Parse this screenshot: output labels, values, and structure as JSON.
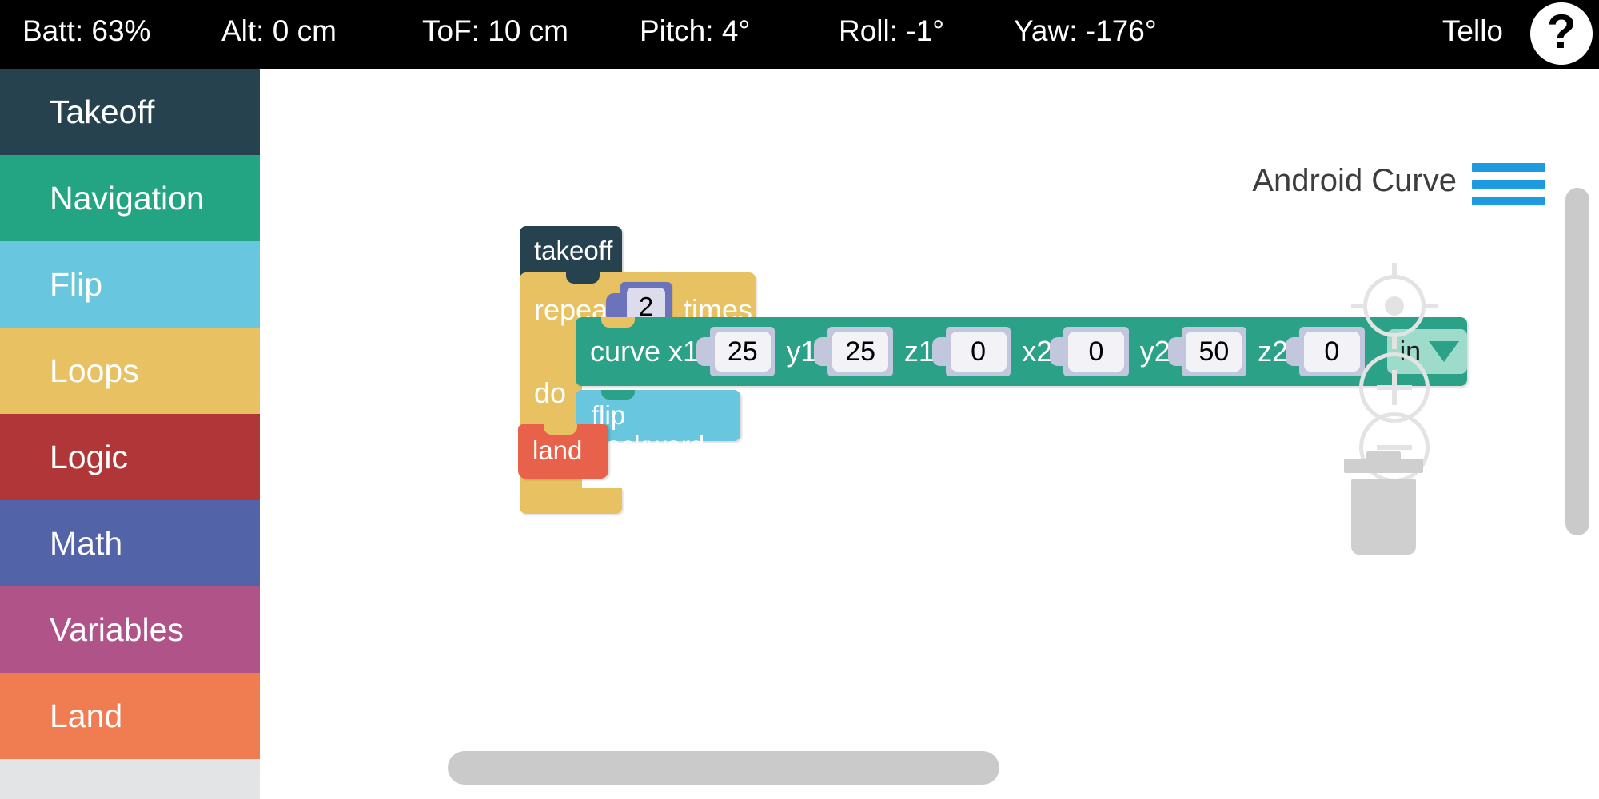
{
  "statusbar": {
    "battery": "Batt: 63%",
    "altitude": "Alt: 0 cm",
    "tof": "ToF: 10 cm",
    "pitch": "Pitch: 4°",
    "roll": "Roll: -1°",
    "yaw": "Yaw: -176°",
    "drone_name": "Tello",
    "help_label": "?"
  },
  "sidebar": {
    "items": [
      {
        "label": "Takeoff",
        "color": "#27424f"
      },
      {
        "label": "Navigation",
        "color": "#23a584"
      },
      {
        "label": "Flip",
        "color": "#68c6de"
      },
      {
        "label": "Loops",
        "color": "#e8c262"
      },
      {
        "label": "Logic",
        "color": "#b03638"
      },
      {
        "label": "Math",
        "color": "#5263a8"
      },
      {
        "label": "Variables",
        "color": "#af5389"
      },
      {
        "label": "Land",
        "color": "#f07c51"
      }
    ]
  },
  "workspace": {
    "project_title": "Android Curve",
    "menu_icon": "hamburger-icon",
    "controls": {
      "center_icon": "crosshair-icon",
      "zoom_in_icon": "plus-icon",
      "zoom_out_icon": "minus-icon",
      "trash_icon": "trash-icon"
    }
  },
  "script": {
    "takeoff": {
      "label": "takeoff",
      "color": "#27424f"
    },
    "repeat": {
      "label": "repeat",
      "times_label": "times",
      "count": "2",
      "do_label": "do",
      "color": "#e8c262",
      "value_color": "#6b73bb"
    },
    "curve": {
      "label": "curve x1",
      "color": "#2ba287",
      "params": [
        {
          "name": "x1",
          "label": "curve x1",
          "value": "25"
        },
        {
          "name": "y1",
          "label": "y1",
          "value": "25"
        },
        {
          "name": "z1",
          "label": "z1",
          "value": "0"
        },
        {
          "name": "x2",
          "label": "x2",
          "value": "0"
        },
        {
          "name": "y2",
          "label": "y2",
          "value": "50"
        },
        {
          "name": "z2",
          "label": "z2",
          "value": "0"
        }
      ],
      "unit": "in"
    },
    "flip": {
      "label": "flip backward",
      "color": "#68c6de"
    },
    "land": {
      "label": "land",
      "color": "#e8614b"
    }
  }
}
